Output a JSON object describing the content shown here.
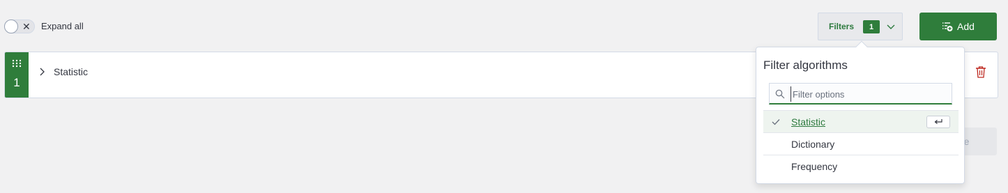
{
  "toolbar": {
    "expand_all_label": "Expand all",
    "filters_label": "Filters",
    "filters_count": "1",
    "add_label": "Add"
  },
  "row": {
    "number": "1",
    "title": "Statistic"
  },
  "hidden_button": {
    "label": "Save"
  },
  "popover": {
    "title": "Filter algorithms",
    "search_placeholder": "Filter options",
    "search_value": "",
    "options": [
      {
        "label": "Statistic",
        "selected": true
      },
      {
        "label": "Dictionary",
        "selected": false
      },
      {
        "label": "Frequency",
        "selected": false
      }
    ]
  },
  "colors": {
    "accent": "#2f7d3b",
    "danger": "#bd271e",
    "background": "#f1f1f2"
  },
  "icons": {
    "toggle": "close-icon",
    "filters_dropdown": "chevron-down-icon",
    "add": "list-add-icon",
    "row_drag": "grip-icon",
    "row_expand": "chevron-right-icon",
    "row_delete": "trash-icon",
    "search": "search-icon",
    "check": "check-icon",
    "enter": "enter-key-icon"
  }
}
